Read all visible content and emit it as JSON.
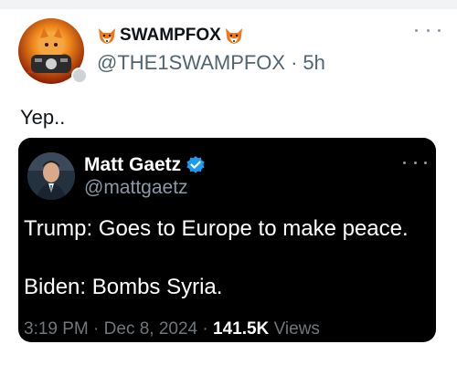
{
  "post": {
    "display_name": "SWAMPFOX",
    "handle": "@THE1SWAMPFOX",
    "separator": "·",
    "time_ago": "5h",
    "text": "Yep.."
  },
  "quoted_post": {
    "display_name": "Matt Gaetz",
    "handle": "@mattgaetz",
    "line1": "Trump: Goes to Europe to make peace.",
    "line2": "Biden: Bombs Syria.",
    "time": "3:19 PM",
    "separator": "·",
    "date": "Dec 8, 2024",
    "views_count": "141.5K",
    "views_label": "Views"
  },
  "colors": {
    "verified_blue": "#1d9bf0",
    "quote_background": "#000000",
    "muted_text": "#536471"
  },
  "icons": [
    "fox-icon",
    "verified-icon",
    "more-icon"
  ]
}
